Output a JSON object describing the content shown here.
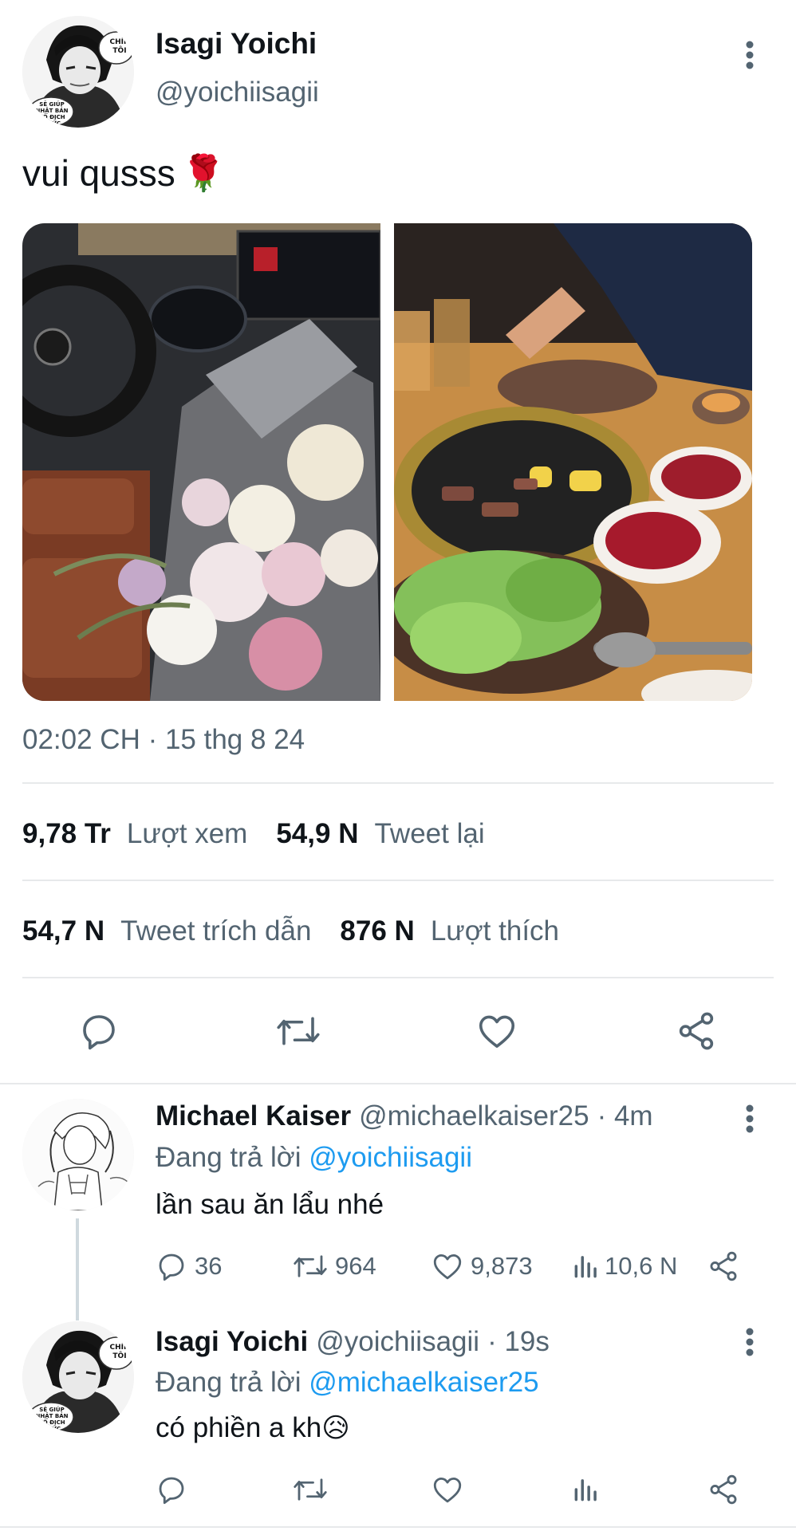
{
  "main_tweet": {
    "author_name": "Isagi Yoichi",
    "author_handle": "@yoichiisagii",
    "text": "vui qusss",
    "emoji": "🌹",
    "avatar_speech_top": "CHÍN TÔI",
    "avatar_speech_bottom": "SẼ GIÚP NHẬT BẢN VÔ ĐỊCH CHỨC",
    "timestamp": "02:02 CH · 15 thg 8 24",
    "stats": {
      "views_num": "9,78 Tr",
      "views_label": "Lượt xem",
      "retweets_num": "54,9 N",
      "retweets_label": "Tweet lại",
      "quotes_num": "54,7 N",
      "quotes_label": "Tweet trích dẫn",
      "likes_num": "876 N",
      "likes_label": "Lượt thích"
    },
    "photos": [
      "bmw-car-interior-with-flower-bouquet",
      "korean-bbq-grill-table"
    ]
  },
  "replies": [
    {
      "author_name": "Michael Kaiser",
      "author_handle": "@michaelkaiser25",
      "time": "· 4m",
      "replying_prefix": "Đang trả lời",
      "replying_to": "@yoichiisagii",
      "text": "lần sau ăn lẩu nhé",
      "counts": {
        "replies": "36",
        "retweets": "964",
        "likes": "9,873",
        "views": "10,6 N"
      }
    },
    {
      "author_name": "Isagi Yoichi",
      "author_handle": "@yoichiisagii",
      "time": "· 19s",
      "replying_prefix": "Đang trả lời",
      "replying_to": "@michaelkaiser25",
      "text": "có phiền a kh",
      "emoji": "😥"
    }
  ],
  "colors": {
    "text": "#0f1419",
    "muted": "#536471",
    "link": "#1d9bf0",
    "divider": "#e7e9eb"
  }
}
